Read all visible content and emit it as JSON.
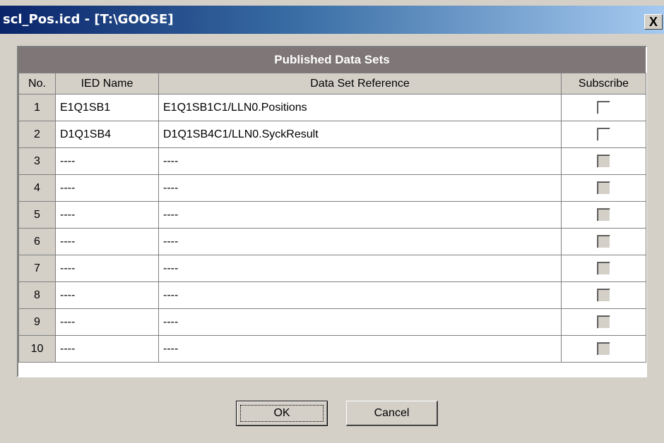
{
  "window": {
    "title": "scl_Pos.icd - [T:\\GOOSE]",
    "close_label": "X"
  },
  "table": {
    "caption": "Published Data Sets",
    "headers": {
      "no": "No.",
      "ied": "IED Name",
      "ref": "Data Set Reference",
      "sub": "Subscribe"
    },
    "rows": [
      {
        "no": "1",
        "ied": "E1Q1SB1",
        "ref": "E1Q1SB1C1/LLN0.Positions",
        "subscribe_enabled": true,
        "checked": false
      },
      {
        "no": "2",
        "ied": "D1Q1SB4",
        "ref": "D1Q1SB4C1/LLN0.SyckResult",
        "subscribe_enabled": true,
        "checked": false
      },
      {
        "no": "3",
        "ied": "----",
        "ref": "----",
        "subscribe_enabled": false,
        "checked": false
      },
      {
        "no": "4",
        "ied": "----",
        "ref": "----",
        "subscribe_enabled": false,
        "checked": false
      },
      {
        "no": "5",
        "ied": "----",
        "ref": "----",
        "subscribe_enabled": false,
        "checked": false
      },
      {
        "no": "6",
        "ied": "----",
        "ref": "----",
        "subscribe_enabled": false,
        "checked": false
      },
      {
        "no": "7",
        "ied": "----",
        "ref": "----",
        "subscribe_enabled": false,
        "checked": false
      },
      {
        "no": "8",
        "ied": "----",
        "ref": "----",
        "subscribe_enabled": false,
        "checked": false
      },
      {
        "no": "9",
        "ied": "----",
        "ref": "----",
        "subscribe_enabled": false,
        "checked": false
      },
      {
        "no": "10",
        "ied": "----",
        "ref": "----",
        "subscribe_enabled": false,
        "checked": false
      }
    ]
  },
  "buttons": {
    "ok": "OK",
    "cancel": "Cancel"
  }
}
